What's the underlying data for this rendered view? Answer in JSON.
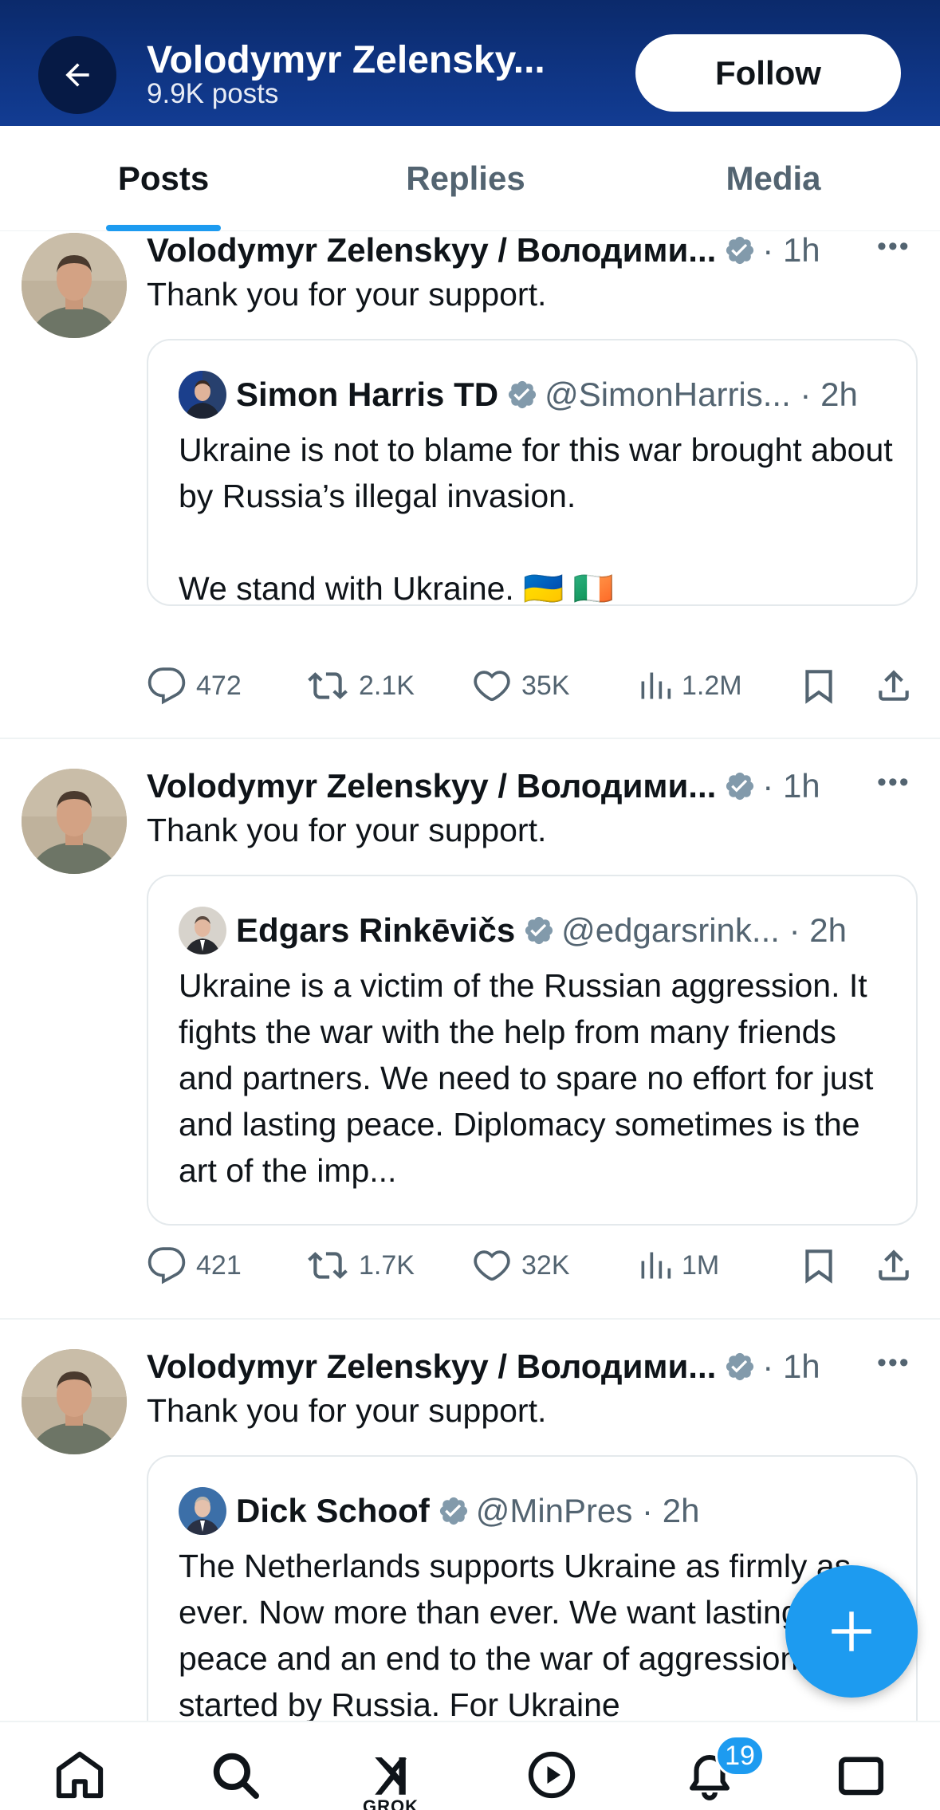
{
  "header": {
    "title": "Volodymyr Zelensky...",
    "posts_count": "9.9K posts",
    "follow_label": "Follow"
  },
  "tabs": [
    {
      "label": "Posts",
      "active": true
    },
    {
      "label": "Replies",
      "active": false
    },
    {
      "label": "Media",
      "active": false
    }
  ],
  "posts": [
    {
      "author": "Volodymyr Zelenskyy / Володими...",
      "time": "1h",
      "text": "Thank you for your support.",
      "quote": {
        "name": "Simon Harris TD",
        "handle": "@SimonHarris...",
        "time": "2h",
        "text": "Ukraine is not to blame for this war brought about by Russia’s illegal invasion.\n\nWe stand with Ukraine. 🇺🇦 🇮🇪"
      },
      "stats": {
        "replies": "472",
        "reposts": "2.1K",
        "likes": "35K",
        "views": "1.2M"
      }
    },
    {
      "author": "Volodymyr Zelenskyy / Володими...",
      "time": "1h",
      "text": "Thank you for your support.",
      "quote": {
        "name": "Edgars Rinkēvičs",
        "handle": "@edgarsrink...",
        "time": "2h",
        "text": "Ukraine is a victim of the Russian aggression. It fights the war with the help from many friends and partners. We need to spare no effort for just and lasting peace. Diplomacy sometimes is the art of the imp..."
      },
      "stats": {
        "replies": "421",
        "reposts": "1.7K",
        "likes": "32K",
        "views": "1M"
      }
    },
    {
      "author": "Volodymyr Zelenskyy / Володими...",
      "time": "1h",
      "text": "Thank you for your support.",
      "quote": {
        "name": "Dick Schoof",
        "handle": "@MinPres",
        "time": "2h",
        "text": "The Netherlands supports Ukraine as firmly as ever. Now more than ever. We want lasting peace and an end to the war of aggression started by Russia. For Ukraine"
      }
    }
  ],
  "bottom_nav": {
    "grok_label": "GROK",
    "notifications_badge": "19"
  },
  "icons": [
    "back-arrow-icon",
    "verified-badge-icon",
    "more-icon",
    "reply-icon",
    "repost-icon",
    "like-icon",
    "views-icon",
    "bookmark-icon",
    "share-icon",
    "compose-plus-icon",
    "home-icon",
    "search-icon",
    "grok-icon",
    "play-icon",
    "bell-icon",
    "messages-icon"
  ],
  "colors": {
    "accent": "#1d9bf0",
    "header_bg": "#0f3584",
    "muted": "#536471"
  }
}
